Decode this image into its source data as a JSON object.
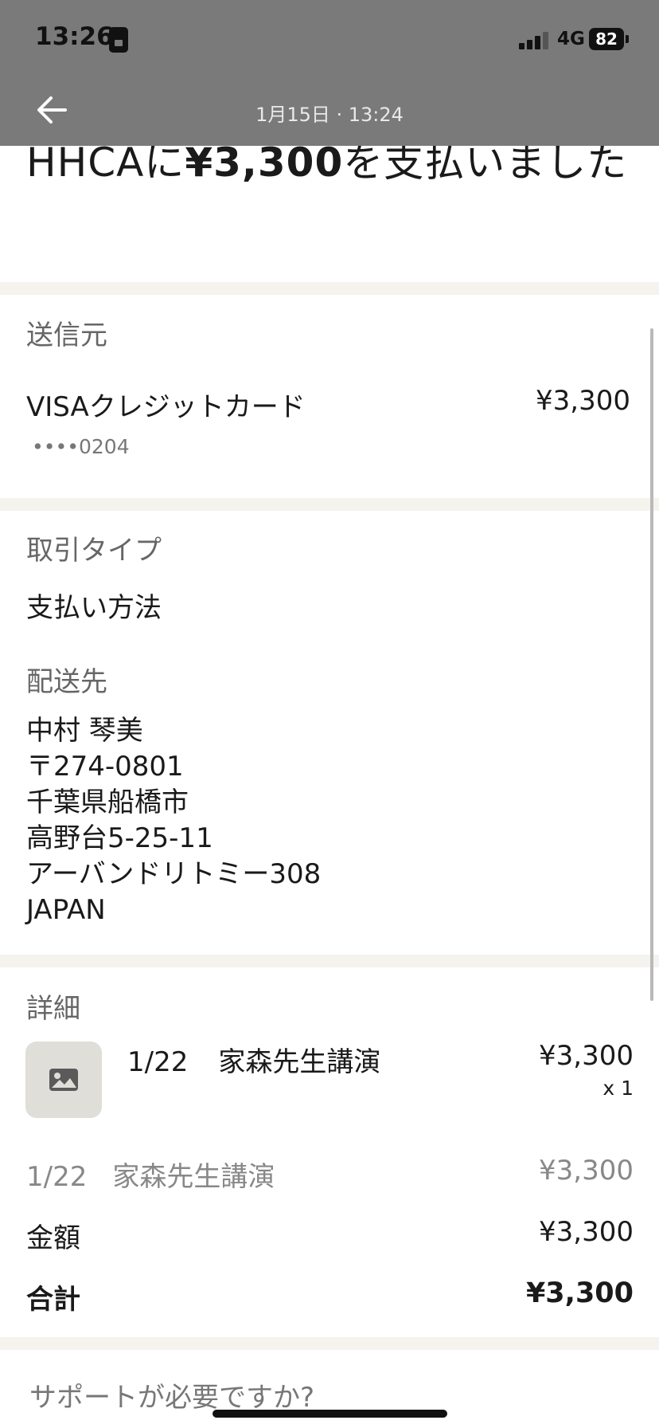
{
  "status_bar": {
    "time": "13:26",
    "network": "4G",
    "battery": "82"
  },
  "nav": {
    "back_icon": "arrow-left-icon",
    "date": "1月15日 · 13:24"
  },
  "headline": {
    "prefix": "HHCAに",
    "amount": "¥3,300",
    "suffix": "を支払いました"
  },
  "source": {
    "label": "送信元",
    "card_name": "VISAクレジットカード",
    "card_amount": "¥3,300",
    "card_mask": "••••0204"
  },
  "transaction": {
    "type_label": "取引タイプ",
    "type_value": "支払い方法",
    "ship_label": "配送先",
    "address_lines": [
      "中村 琴美",
      "〒274-0801",
      "千葉県船橋市",
      "高野台5-25-11",
      "アーバンドリトミー308",
      "JAPAN"
    ]
  },
  "details": {
    "label": "詳細",
    "item": {
      "date": "1/22",
      "name": "家森先生講演",
      "price": "¥3,300",
      "qty": "x 1",
      "thumb_icon": "image-placeholder-icon"
    },
    "line": {
      "date": "1/22",
      "name": "家森先生講演",
      "price": "¥3,300"
    },
    "subtotal_label": "金額",
    "subtotal": "¥3,300",
    "total_label": "合計",
    "total": "¥3,300"
  },
  "support": {
    "text": "サポートが必要ですか?"
  },
  "colors": {
    "overlay": "#7a7a7a",
    "divider": "#f4f3ee",
    "muted_text": "#666666"
  }
}
